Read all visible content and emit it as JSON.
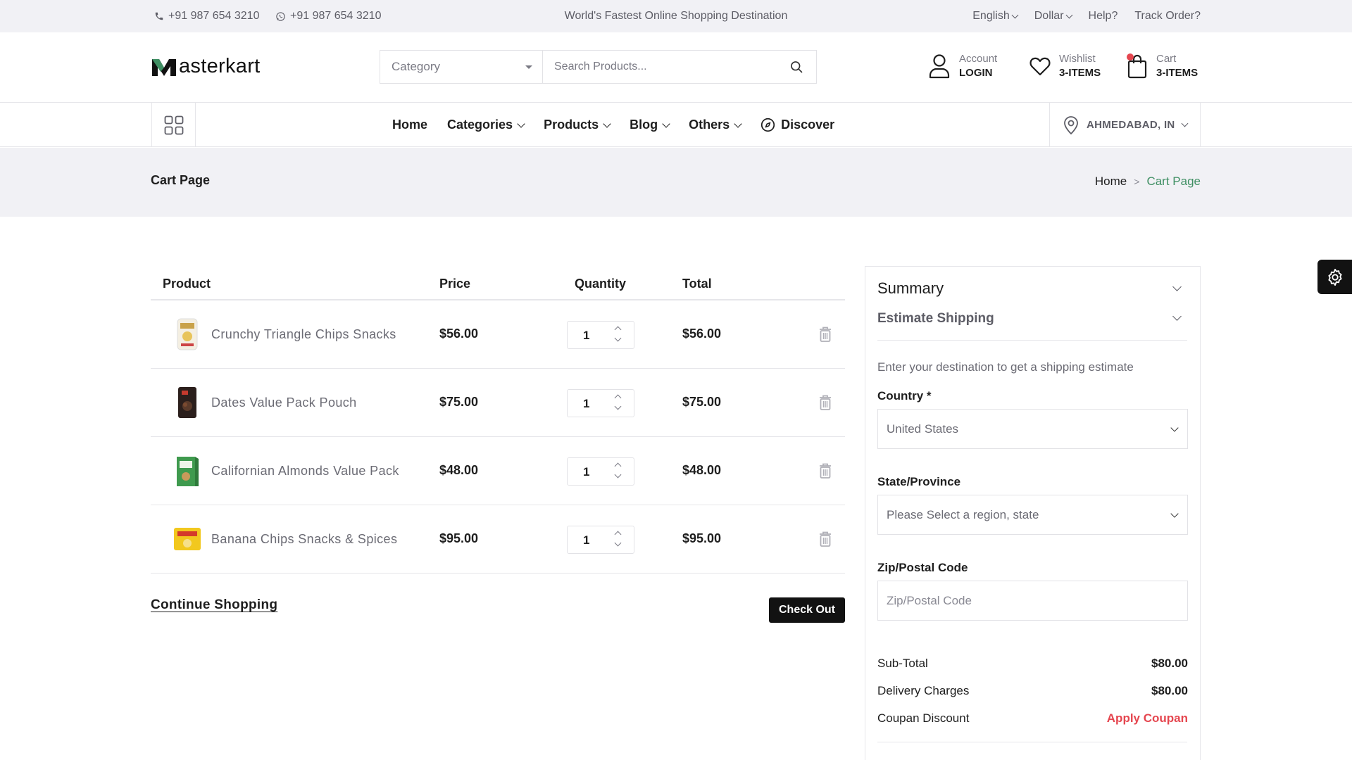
{
  "topbar": {
    "phone1": "+91 987 654 3210",
    "phone2": "+91 987 654 3210",
    "tagline": "World's Fastest Online Shopping Destination",
    "language": "English",
    "currency": "Dollar",
    "help": "Help?",
    "track": "Track Order?"
  },
  "header": {
    "logo_text": "asterkart",
    "category_placeholder": "Category",
    "search_placeholder": "Search Products...",
    "account_label": "Account",
    "account_value": "LOGIN",
    "wishlist_label": "Wishlist",
    "wishlist_value": "3-ITEMS",
    "cart_label": "Cart",
    "cart_value": "3-ITEMS"
  },
  "nav": {
    "items": [
      "Home",
      "Categories",
      "Products",
      "Blog",
      "Others",
      "Discover"
    ],
    "location": "AHMEDABAD, IN"
  },
  "page": {
    "title": "Cart Page",
    "breadcrumb_home": "Home",
    "breadcrumb_sep": ">",
    "breadcrumb_current": "Cart Page"
  },
  "cart": {
    "headers": {
      "product": "Product",
      "price": "Price",
      "quantity": "Quantity",
      "total": "Total"
    },
    "rows": [
      {
        "name": "Crunchy Triangle Chips Snacks",
        "price": "$56.00",
        "qty": "1",
        "total": "$56.00",
        "thumb": "chips-pack"
      },
      {
        "name": "Dates Value Pack Pouch",
        "price": "$75.00",
        "qty": "1",
        "total": "$75.00",
        "thumb": "dates-pouch"
      },
      {
        "name": "Californian Almonds Value Pack",
        "price": "$48.00",
        "qty": "1",
        "total": "$48.00",
        "thumb": "almonds-box"
      },
      {
        "name": "Banana Chips Snacks & Spices",
        "price": "$95.00",
        "qty": "1",
        "total": "$95.00",
        "thumb": "banana-chips-pack"
      }
    ],
    "continue_label": "Continue Shopping",
    "checkout_label": "Check Out"
  },
  "summary": {
    "title": "Summary",
    "estimate_title": "Estimate Shipping",
    "hint": "Enter your destination to get a shipping estimate",
    "country_label": "Country *",
    "country_value": "United States",
    "state_label": "State/Province",
    "state_value": "Please Select a region, state",
    "zip_label": "Zip/Postal Code",
    "zip_placeholder": "Zip/Postal Code",
    "subtotal_label": "Sub-Total",
    "subtotal_value": "$80.00",
    "delivery_label": "Delivery Charges",
    "delivery_value": "$80.00",
    "coupon_label": "Coupan Discount",
    "coupon_action": "Apply Coupan"
  },
  "colors": {
    "brand_green": "#3f8f63",
    "accent_red": "#e5464f",
    "dark": "#121212",
    "band_bg": "#f1f1f5"
  }
}
